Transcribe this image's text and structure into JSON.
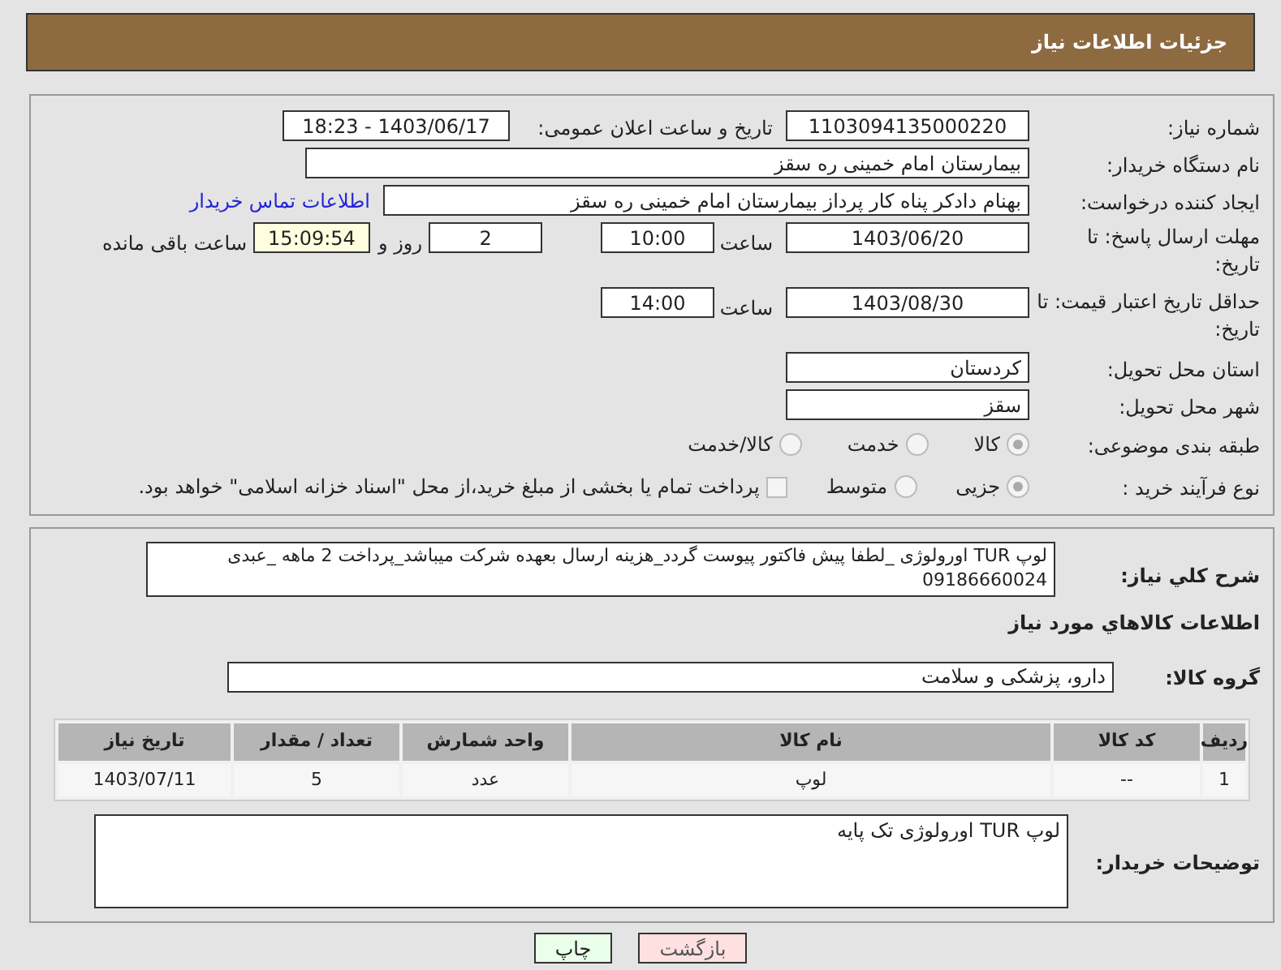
{
  "header": {
    "title": "جزئیات اطلاعات نیاز"
  },
  "details": {
    "need_number": {
      "label": "شماره نیاز:",
      "value": "1103094135000220"
    },
    "announce": {
      "label": "تاریخ و ساعت اعلان عمومی:",
      "value": "1403/06/17 - 18:23"
    },
    "buyer": {
      "label": "نام دستگاه خریدار:",
      "value": "بیمارستان امام خمینی  ره  سقز"
    },
    "creator": {
      "label": "ایجاد کننده درخواست:",
      "value": "بهنام دادکر پناه کار پرداز بیمارستان امام خمینی  ره  سقز",
      "link": "اطلاعات تماس خریدار"
    },
    "deadline": {
      "label": "مهلت ارسال پاسخ: تا تاریخ:",
      "date": "1403/06/20",
      "time_label": "ساعت",
      "time": "10:00",
      "days": "2",
      "days_label": "روز و",
      "remaining": "15:09:54",
      "remaining_label": "ساعت باقی مانده"
    },
    "validity": {
      "label": "حداقل تاریخ اعتبار قیمت: تا تاریخ:",
      "date": "1403/08/30",
      "time_label": "ساعت",
      "time": "14:00"
    },
    "province": {
      "label": "استان محل تحویل:",
      "value": "کردستان"
    },
    "city": {
      "label": "شهر محل تحویل:",
      "value": "سقز"
    },
    "category": {
      "label": "طبقه بندی موضوعی:",
      "options": [
        {
          "label": "کالا",
          "selected": true
        },
        {
          "label": "خدمت",
          "selected": false
        },
        {
          "label": "کالا/خدمت",
          "selected": false
        }
      ]
    },
    "process": {
      "label": "نوع فرآیند خرید :",
      "options": [
        {
          "label": "جزیی",
          "selected": true
        },
        {
          "label": "متوسط",
          "selected": false
        }
      ],
      "payment": {
        "label": "پرداخت تمام یا بخشی از مبلغ خرید،از محل \"اسناد خزانه اسلامی\" خواهد بود.",
        "checked": false
      }
    }
  },
  "description": {
    "label": "شرح کلي نیاز:",
    "value": "لوپ TUR اورولوژی _لطفا پیش فاکتور پیوست گردد_هزینه ارسال بعهده شرکت میباشد_پرداخت 2 ماهه _عبدی 09186660024"
  },
  "goods": {
    "title": "اطلاعات کالاهاي مورد نیاز",
    "group_label": "گروه کالا:",
    "group": "دارو، پزشکی و سلامت",
    "table": {
      "columns": [
        "ردیف",
        "کد کالا",
        "نام کالا",
        "واحد شمارش",
        "تعداد / مقدار",
        "تاریخ نیاز"
      ],
      "rows": [
        [
          "1",
          "--",
          "لوپ",
          "عدد",
          "5",
          "1403/07/11"
        ]
      ]
    }
  },
  "buyer_notes": {
    "label": "توضیحات خریدار:",
    "value": "لوپ TUR اورولوژی تک پایه"
  },
  "buttons": [
    {
      "label": "بازگشت",
      "kind": "back"
    },
    {
      "label": "چاپ",
      "kind": "print"
    }
  ]
}
